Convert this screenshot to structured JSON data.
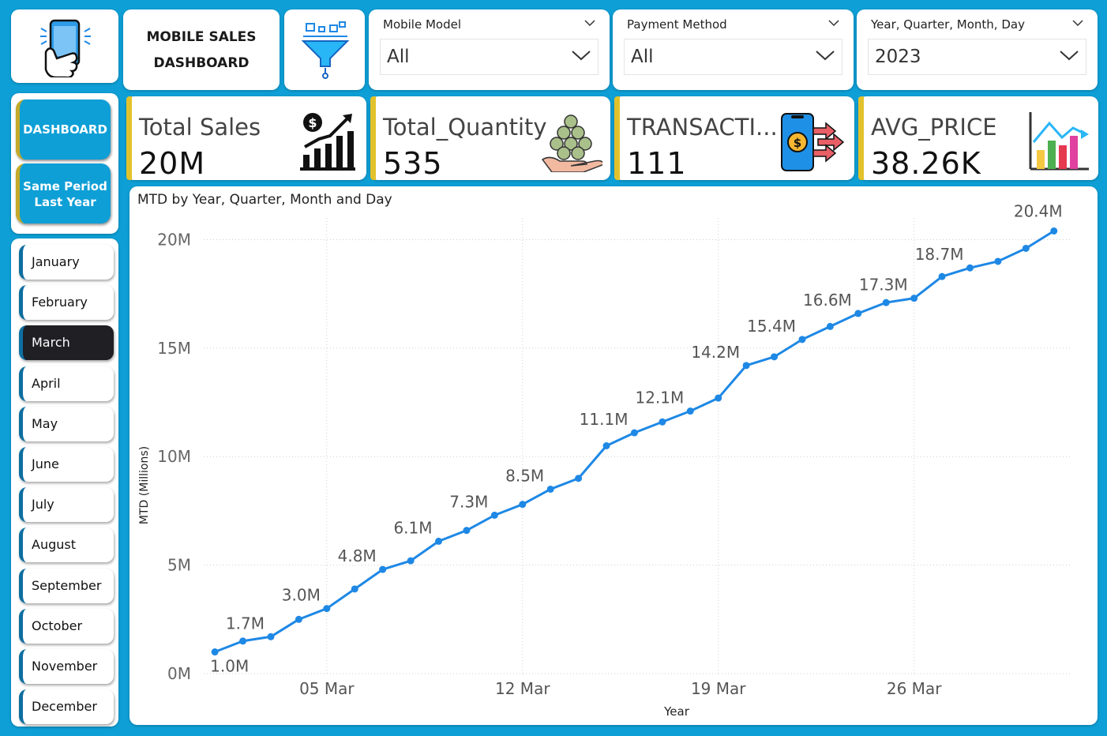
{
  "header": {
    "title_line1": "MOBILE SALES",
    "title_line2": "DASHBOARD"
  },
  "icons": {
    "logo": "phone-hand-icon",
    "filter": "funnel-filter-icon",
    "total_sales": "sales-growth-chart-icon",
    "total_quantity": "coins-stack-hand-icon",
    "transactions": "phone-payment-transfer-icon",
    "avg_price": "bar-chart-trend-icon"
  },
  "slicers": [
    {
      "label": "Mobile Model",
      "value": "All"
    },
    {
      "label": "Payment Method",
      "value": "All"
    },
    {
      "label": "Year, Quarter, Month, Day",
      "value": "2023"
    }
  ],
  "kpis": [
    {
      "label": "Total Sales",
      "value": "20M"
    },
    {
      "label": "Total_Quantity",
      "value": "535"
    },
    {
      "label": "TRANSACTI...",
      "value": "111"
    },
    {
      "label": "AVG_PRICE",
      "value": "38.26K"
    }
  ],
  "nav": {
    "dashboard": "DASHBOARD",
    "same_period_line1": "Same Period",
    "same_period_line2": "Last Year"
  },
  "months": [
    "January",
    "February",
    "March",
    "April",
    "May",
    "June",
    "July",
    "August",
    "September",
    "October",
    "November",
    "December"
  ],
  "active_month": "March",
  "colors": {
    "background": "#0e9fd6",
    "accent_bar": "#e2c22c",
    "line": "#1e88e5",
    "active_month_bg": "#1f1f24"
  },
  "chart_data": {
    "type": "line",
    "title": "MTD by Year, Quarter, Month and Day",
    "xlabel": "Year",
    "ylabel": "MTD (Millions)",
    "x_ticks": [
      "05 Mar",
      "12 Mar",
      "19 Mar",
      "26 Mar"
    ],
    "y_ticks": [
      "0M",
      "5M",
      "10M",
      "15M",
      "20M"
    ],
    "ylim": [
      0,
      21
    ],
    "grid": true,
    "x": [
      1,
      2,
      3,
      4,
      5,
      6,
      7,
      8,
      9,
      10,
      11,
      12,
      13,
      14,
      15,
      16,
      17,
      18,
      19,
      20,
      21,
      22,
      23,
      24,
      25,
      26,
      27,
      28,
      29,
      30,
      31
    ],
    "values": [
      1.0,
      1.5,
      1.7,
      2.5,
      3.0,
      3.9,
      4.8,
      5.2,
      6.1,
      6.6,
      7.3,
      7.8,
      8.5,
      9.0,
      10.5,
      11.1,
      11.6,
      12.1,
      12.7,
      14.2,
      14.6,
      15.4,
      16.0,
      16.6,
      17.1,
      17.3,
      18.3,
      18.7,
      19.0,
      19.6,
      20.4
    ],
    "data_labels": [
      {
        "day": 1,
        "label": "1.0M"
      },
      {
        "day": 3,
        "label": "1.7M"
      },
      {
        "day": 5,
        "label": "3.0M"
      },
      {
        "day": 7,
        "label": "4.8M"
      },
      {
        "day": 9,
        "label": "6.1M"
      },
      {
        "day": 11,
        "label": "7.3M"
      },
      {
        "day": 13,
        "label": "8.5M"
      },
      {
        "day": 16,
        "label": "11.1M"
      },
      {
        "day": 18,
        "label": "12.1M"
      },
      {
        "day": 20,
        "label": "14.2M"
      },
      {
        "day": 22,
        "label": "15.4M"
      },
      {
        "day": 24,
        "label": "16.6M"
      },
      {
        "day": 26,
        "label": "17.3M"
      },
      {
        "day": 28,
        "label": "18.7M"
      },
      {
        "day": 31,
        "label": "20.4M"
      }
    ]
  }
}
